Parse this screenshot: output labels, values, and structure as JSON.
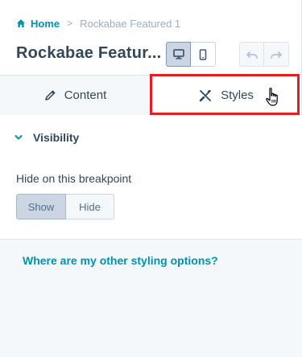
{
  "breadcrumb": {
    "home_label": "Home",
    "separator": ">",
    "current": "Rockabae Featured 1",
    "home_icon": "home-icon"
  },
  "header": {
    "title": "Rockabae Featur...",
    "device_buttons": [
      "desktop-icon",
      "mobile-icon"
    ],
    "history_buttons": [
      "undo-icon",
      "redo-icon"
    ]
  },
  "tabs": [
    {
      "label": "Content",
      "icon": "pencil-icon",
      "active": false
    },
    {
      "label": "Styles",
      "icon": "styles-icon",
      "active": true
    }
  ],
  "section": {
    "title": "Visibility",
    "field_label": "Hide on this breakpoint",
    "toggle": {
      "options": [
        "Show",
        "Hide"
      ],
      "selected": "Show"
    }
  },
  "help_link": "Where are my other styling options?",
  "colors": {
    "accent": "#0091ae",
    "text": "#33475b",
    "highlight": "#e41e26",
    "panel_bg": "#f5f8fa"
  }
}
